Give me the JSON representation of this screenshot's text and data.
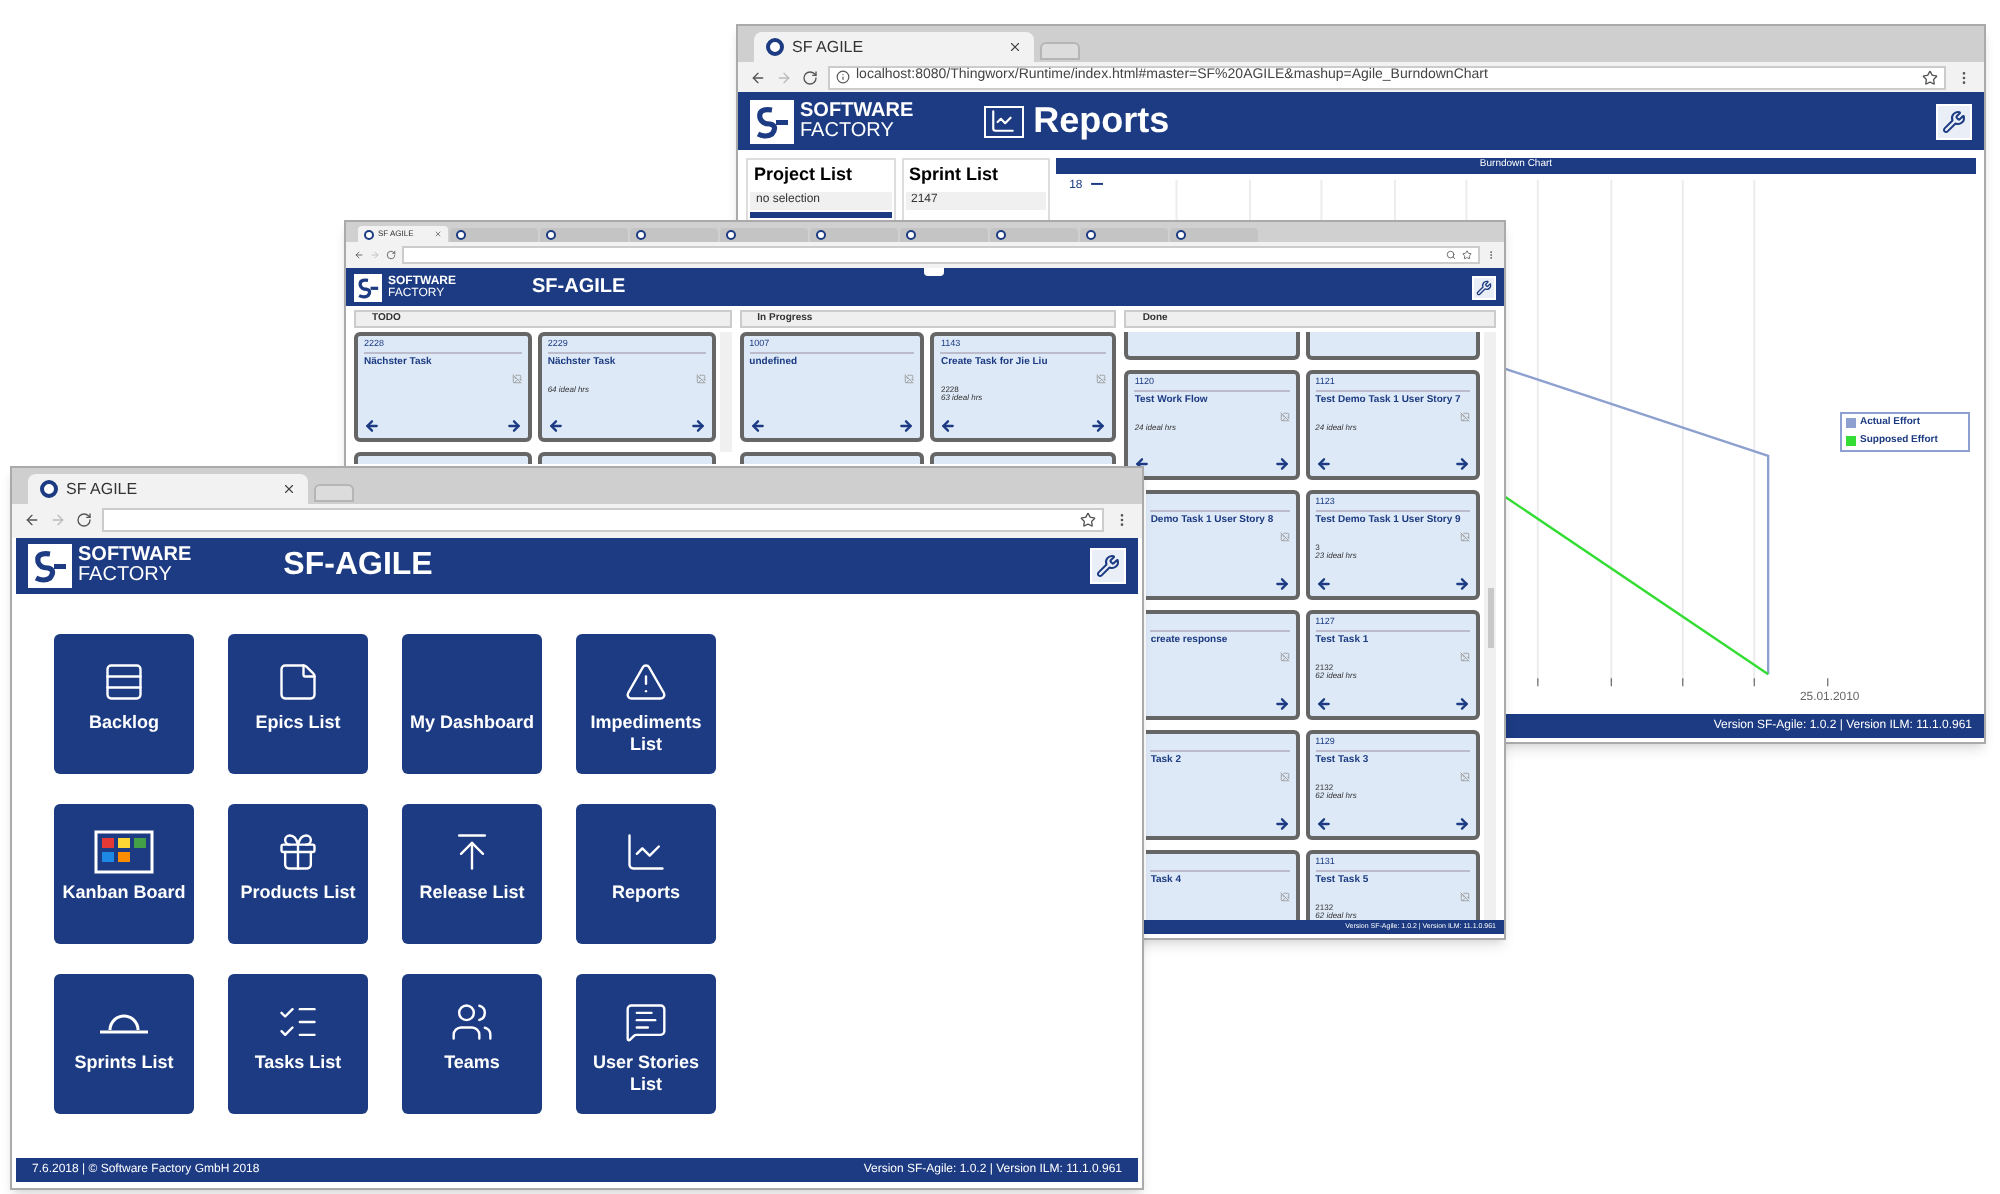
{
  "reports_window": {
    "tabs": [
      {
        "title": "SF AGILE",
        "selected": true
      }
    ],
    "url": "localhost:8080/Thingworx/Runtime/index.html#master=SF%20AGILE&mashup=Agile_BurndownChart",
    "logo_lines": [
      "SOFTWARE",
      "FACTORY"
    ],
    "title": "Reports",
    "project_list": {
      "title": "Project List",
      "items": [
        {
          "label": "no selection",
          "selected": false
        },
        {
          "selected": true
        }
      ]
    },
    "sprint_list": {
      "title": "Sprint List",
      "items": [
        {
          "label": "2147",
          "selected": false
        }
      ]
    },
    "chart": {
      "title": "Burndown Chart",
      "y_tick": "18",
      "x_label": "25.01.2010",
      "legend": [
        {
          "label": "Actual Effort",
          "color": "#8da0cf"
        },
        {
          "label": "Supposed Effort",
          "color": "#33dd33"
        }
      ]
    },
    "footer": "Version SF-Agile: 1.0.2 | Version ILM: 11.1.0.961"
  },
  "kanban_window": {
    "tabs": [
      {
        "title": "SF AGILE",
        "selected": true
      },
      {
        "selected": false
      },
      {
        "selected": false
      },
      {
        "selected": false
      },
      {
        "selected": false
      },
      {
        "selected": false
      },
      {
        "selected": false
      },
      {
        "selected": false
      },
      {
        "selected": false
      },
      {
        "selected": false
      }
    ],
    "logo_lines": [
      "SOFTWARE",
      "FACTORY"
    ],
    "title": "SF-AGILE",
    "columns": [
      {
        "title": "TODO",
        "cards": [
          {
            "kind": "full",
            "id": "2228",
            "title": "Nächster Task"
          },
          {
            "kind": "full",
            "id": "2229",
            "title": "Nächster Task",
            "hours": "64 ideal hrs"
          },
          {
            "kind": "stub"
          },
          {
            "kind": "stub"
          }
        ]
      },
      {
        "title": "In Progress",
        "cards": [
          {
            "kind": "full",
            "id": "1007",
            "title": "undefined"
          },
          {
            "kind": "full",
            "id": "1143",
            "title": "Create Task for Jie Liu",
            "estimate": "2228",
            "hours": "63 ideal hrs"
          },
          {
            "kind": "stub"
          },
          {
            "kind": "stub"
          }
        ]
      },
      {
        "title": "Done",
        "cards": [
          {
            "kind": "scrolled"
          },
          {
            "kind": "scrolled"
          },
          {
            "kind": "full",
            "id": "1120",
            "title": "Test Work Flow",
            "hours": "24 ideal hrs"
          },
          {
            "kind": "full",
            "id": "1121",
            "title": "Test Demo Task 1 User Story 7",
            "hours": "24 ideal hrs"
          },
          {
            "kind": "cut",
            "title": "Demo Task 1 User Story 8"
          },
          {
            "kind": "full",
            "id": "1123",
            "title": "Test Demo Task 1 User Story 9",
            "estimate": "3",
            "hours": "23 ideal hrs"
          },
          {
            "kind": "cut",
            "title": "create response"
          },
          {
            "kind": "full",
            "id": "1127",
            "title": "Test Task 1",
            "estimate": "2132",
            "hours": "62 ideal hrs"
          },
          {
            "kind": "cut",
            "title": "Task 2"
          },
          {
            "kind": "full",
            "id": "1129",
            "title": "Test Task 3",
            "estimate": "2132",
            "hours": "62 ideal hrs"
          },
          {
            "kind": "cut",
            "title": "Task 4"
          },
          {
            "kind": "full",
            "id": "1131",
            "title": "Test Task 5",
            "estimate": "2132",
            "hours": "62 ideal hrs"
          }
        ]
      }
    ],
    "footer": "Version SF-Agile: 1.0.2 | Version ILM: 11.1.0.961"
  },
  "home_window": {
    "tabs": [
      {
        "title": "SF AGILE",
        "selected": true
      }
    ],
    "logo_lines": [
      "SOFTWARE",
      "FACTORY"
    ],
    "title": "SF-AGILE",
    "tiles": [
      {
        "label": "Backlog",
        "kind": "rows"
      },
      {
        "label": "Epics List",
        "kind": "note"
      },
      {
        "label": "My Dashboard",
        "kind": "blank"
      },
      {
        "label": "Impediments List",
        "kind": "warning"
      },
      {
        "label": "Kanban Board",
        "kind": "kanban"
      },
      {
        "label": "Products List",
        "kind": "gift"
      },
      {
        "label": "Release List",
        "kind": "release"
      },
      {
        "label": "Reports",
        "kind": "chart"
      },
      {
        "label": "Sprints List",
        "kind": "sprint"
      },
      {
        "label": "Tasks List",
        "kind": "tasks"
      },
      {
        "label": "Teams",
        "kind": "users"
      },
      {
        "label": "User Stories List",
        "kind": "message"
      }
    ],
    "footer_left": "7.6.2018 | © Software Factory GmbH 2018",
    "footer_right": "Version SF-Agile: 1.0.2 | Version ILM: 11.1.0.961"
  }
}
